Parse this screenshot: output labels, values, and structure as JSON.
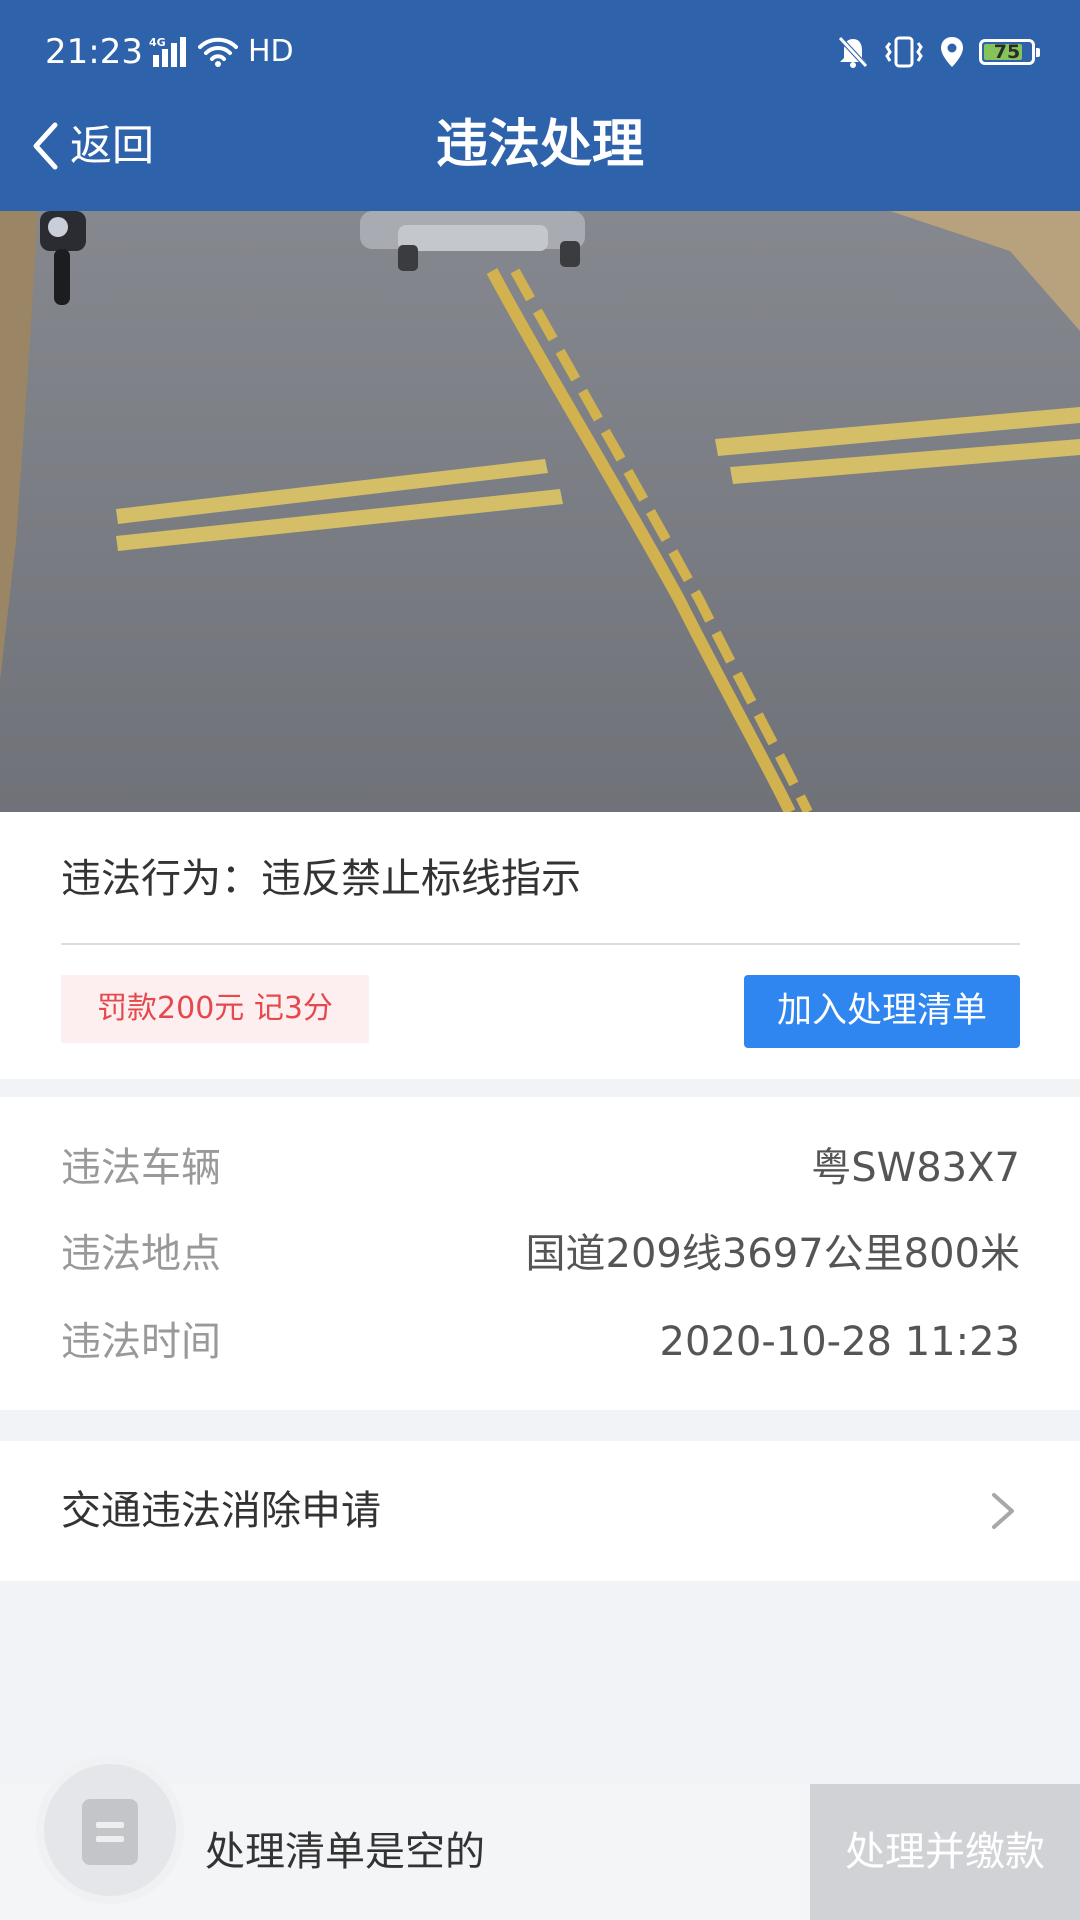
{
  "status_bar": {
    "time": "21:23",
    "network": "4G",
    "hd": "HD",
    "battery": "75"
  },
  "header": {
    "back_label": "返回",
    "title": "违法处理"
  },
  "violation": {
    "behavior_text": "违法行为：违反禁止标线指示",
    "penalty": "罚款200元 记3分",
    "add_button": "加入处理清单"
  },
  "details": [
    {
      "label": "违法车辆",
      "value": "粤SW83X7"
    },
    {
      "label": "违法地点",
      "value": "国道209线3697公里800米"
    },
    {
      "label": "违法时间",
      "value": "2020-10-28 11:23"
    }
  ],
  "elimination": {
    "label": "交通违法消除申请"
  },
  "bottom_bar": {
    "empty_text": "处理清单是空的",
    "pay_button": "处理并缴款"
  },
  "colors": {
    "header": "#2e62aa",
    "primary_button": "#2f86f0",
    "penalty_text": "#e5484d",
    "penalty_bg": "#fdeff0",
    "disabled_button": "#d0d2d6"
  },
  "icons": [
    "signal-icon",
    "wifi-icon",
    "mute-icon",
    "vibrate-icon",
    "location-icon",
    "battery-icon",
    "back-chevron-icon",
    "chevron-right-icon",
    "cart-icon"
  ]
}
